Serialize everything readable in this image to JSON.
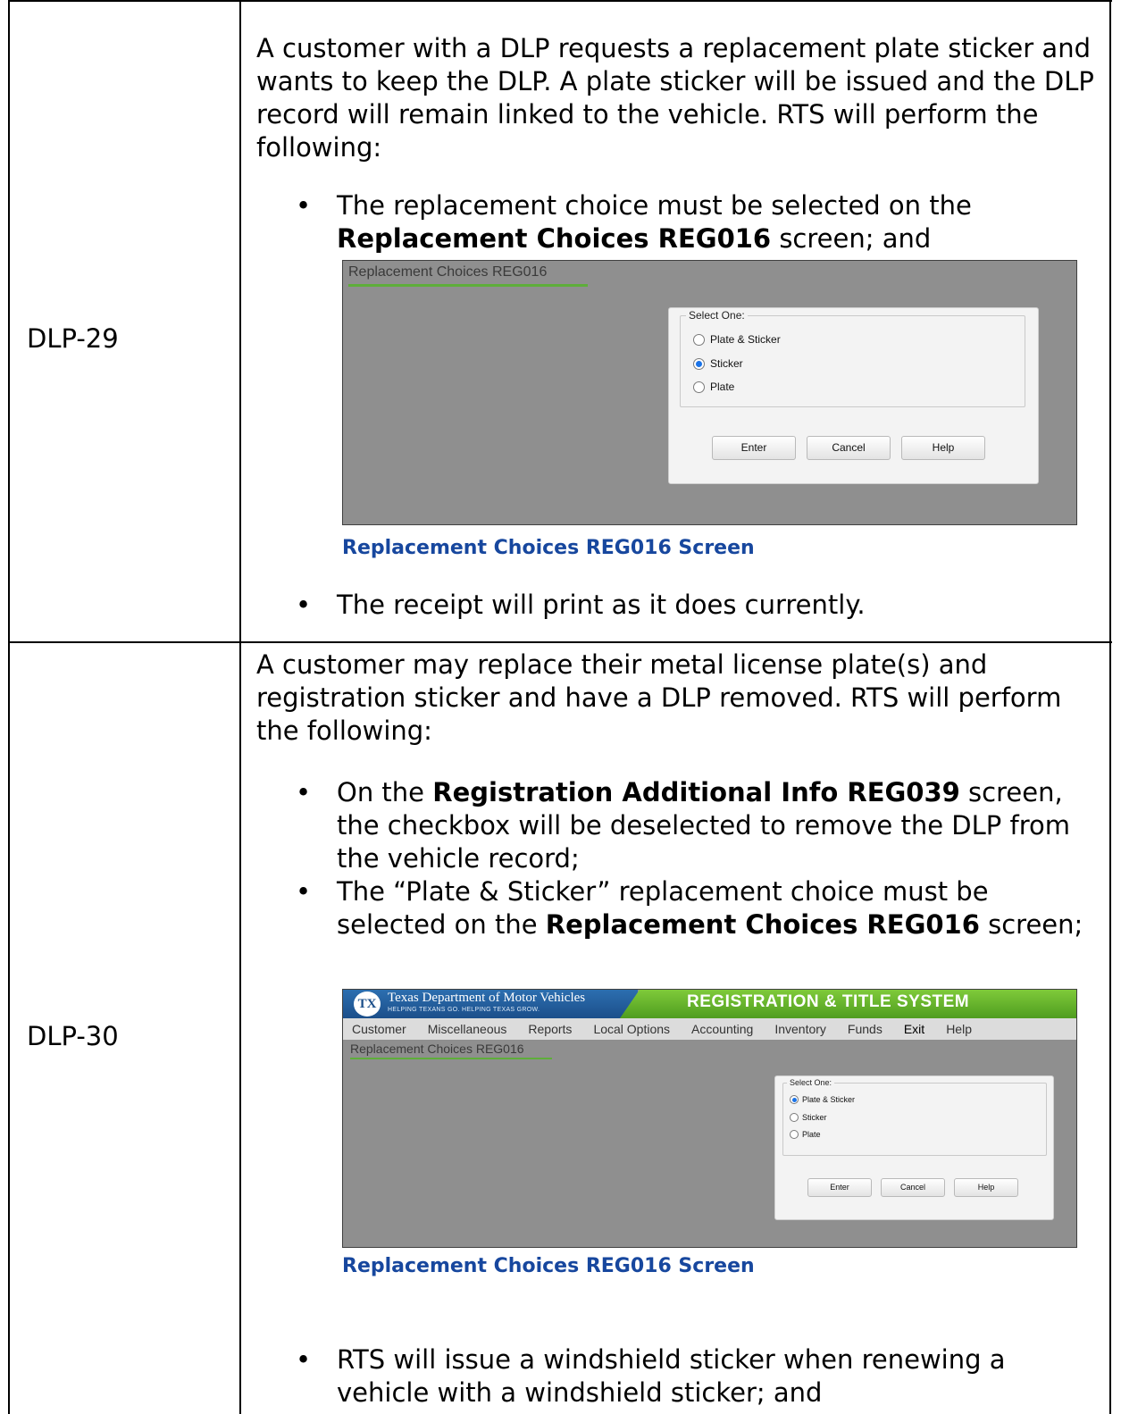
{
  "rows": [
    {
      "id": "DLP-29",
      "intro": "A customer with a DLP requests a replacement plate sticker and wants to keep the DLP. A plate sticker will be issued and the DLP record will remain linked to the vehicle. RTS will perform the following:",
      "bullet1_pre": "The replacement choice must be selected on the ",
      "bullet1_bold": "Replacement Choices REG016",
      "bullet1_post": " screen; and",
      "caption": "Replacement Choices REG016 Screen",
      "bullet2": "The receipt will print as it does currently.",
      "screen": {
        "title": "Replacement Choices REG016",
        "group_label": "Select One:",
        "options": [
          "Plate & Sticker",
          "Sticker",
          "Plate"
        ],
        "selected": "Sticker",
        "buttons": [
          "Enter",
          "Cancel",
          "Help"
        ]
      }
    },
    {
      "id": "DLP-30",
      "intro": "A customer may replace their metal license plate(s) and registration sticker and have a DLP removed. RTS will perform the following:",
      "b1_pre": "On the ",
      "b1_bold": "Registration Additional Info REG039",
      "b1_post": " screen, the checkbox will be deselected to remove the DLP from the vehicle record;",
      "b2_pre": "The “Plate & Sticker” replacement choice must be selected on the ",
      "b2_bold": "Replacement Choices REG016",
      "b2_post": " screen;",
      "caption": "Replacement Choices REG016 Screen",
      "b3": "RTS will issue a windshield sticker when renewing a vehicle with a windshield sticker; and",
      "screen": {
        "agency": "Texas Department of Motor Vehicles",
        "agency_tagline": "HELPING TEXANS GO. HELPING TEXAS GROW.",
        "system_title": "REGISTRATION & TITLE SYSTEM",
        "menu": [
          "Customer",
          "Miscellaneous",
          "Reports",
          "Local Options",
          "Accounting",
          "Inventory",
          "Funds",
          "Exit",
          "Help"
        ],
        "title": "Replacement Choices REG016",
        "group_label": "Select One:",
        "options": [
          "Plate & Sticker",
          "Sticker",
          "Plate"
        ],
        "selected": "Plate & Sticker",
        "buttons": [
          "Enter",
          "Cancel",
          "Help"
        ]
      }
    }
  ]
}
